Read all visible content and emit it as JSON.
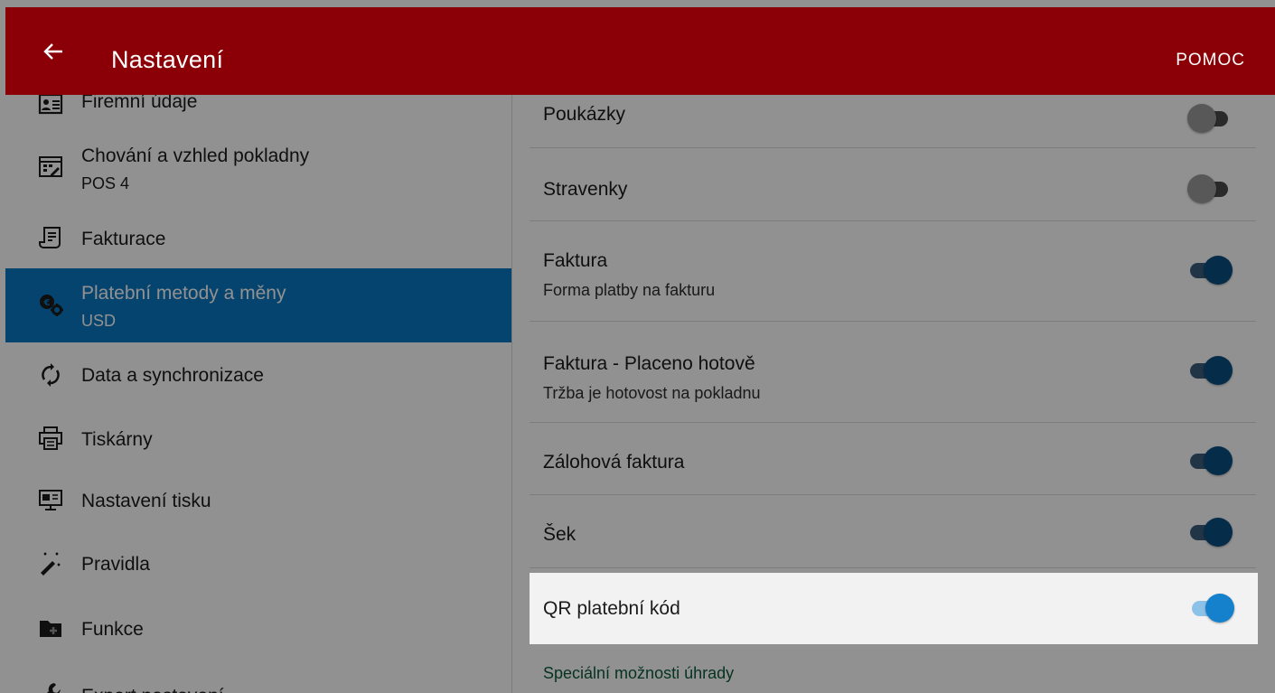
{
  "appbar": {
    "title": "Nastavení",
    "help_label": "POMOC"
  },
  "sidebar": {
    "items": [
      {
        "label": "Firemní údaje",
        "icon": "id-card-icon"
      },
      {
        "label": "Chování a vzhled pokladny",
        "sublabel": "POS 4",
        "icon": "pos-display-icon"
      },
      {
        "label": "Fakturace",
        "icon": "invoice-icon"
      },
      {
        "label": "Platební metody a měny",
        "sublabel": "USD",
        "icon": "currency-settings-icon",
        "active": true
      },
      {
        "label": "Data a synchronizace",
        "icon": "sync-icon"
      },
      {
        "label": "Tiskárny",
        "icon": "printer-icon"
      },
      {
        "label": "Nastavení tisku",
        "icon": "print-settings-icon"
      },
      {
        "label": "Pravidla",
        "icon": "magic-wand-icon"
      },
      {
        "label": "Funkce",
        "icon": "folder-plus-icon"
      },
      {
        "label": "Expert nastavení",
        "icon": "wrench-icon"
      }
    ]
  },
  "payment_methods": [
    {
      "title": "Poukázky",
      "enabled": false
    },
    {
      "title": "Stravenky",
      "enabled": false
    },
    {
      "title": "Faktura",
      "subtitle": "Forma platby na fakturu",
      "enabled": true
    },
    {
      "title": "Faktura - Placeno hotově",
      "subtitle": "Tržba je hotovost na pokladnu",
      "enabled": true
    },
    {
      "title": "Zálohová faktura",
      "enabled": true
    },
    {
      "title": "Šek",
      "enabled": true
    },
    {
      "title": "QR platební kód",
      "enabled": true,
      "highlighted": true
    }
  ],
  "section": {
    "special_payment_options": "Speciální možnosti úhrady"
  },
  "colors": {
    "appbar": "#8b0007",
    "active_nav": "#0a78c2",
    "toggle_on": "#1580cc",
    "section_header": "#0c5a3a"
  }
}
